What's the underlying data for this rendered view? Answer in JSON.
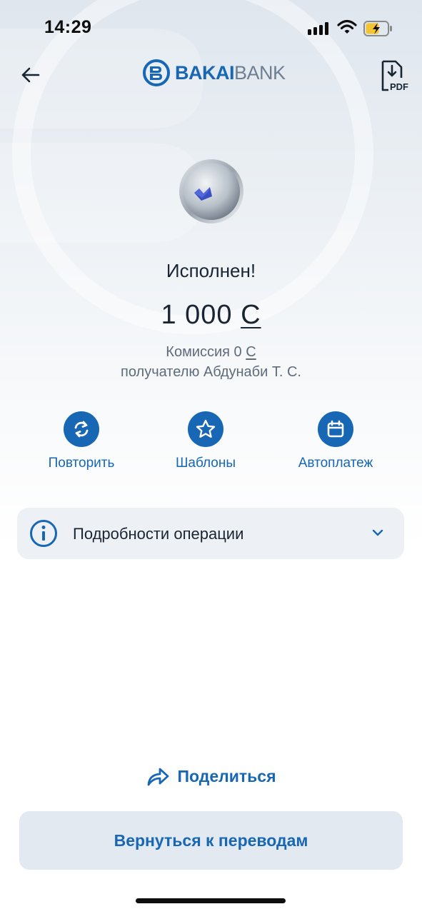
{
  "status_bar": {
    "time": "14:29"
  },
  "header": {
    "logo_bakai": "BAKAI",
    "logo_bank": "BANK",
    "pdf_label": "PDF"
  },
  "result": {
    "title": "Исполнен!",
    "amount": "1 000",
    "currency_symbol": "С",
    "commission_prefix": "Комиссия 0",
    "recipient": "получателю Абдунаби Т. С."
  },
  "actions": [
    {
      "label": "Повторить",
      "icon": "repeat-icon"
    },
    {
      "label": "Шаблоны",
      "icon": "star-icon"
    },
    {
      "label": "Автоплатеж",
      "icon": "calendar-icon"
    }
  ],
  "details": {
    "label": "Подробности операции",
    "icon": "info-icon"
  },
  "share": {
    "label": "Поделиться",
    "icon": "share-icon"
  },
  "return_button": {
    "label": "Вернуться к переводам"
  },
  "colors": {
    "accent": "#1767b4",
    "logo_grey": "#6f7f92",
    "panel": "#edf1f5"
  }
}
